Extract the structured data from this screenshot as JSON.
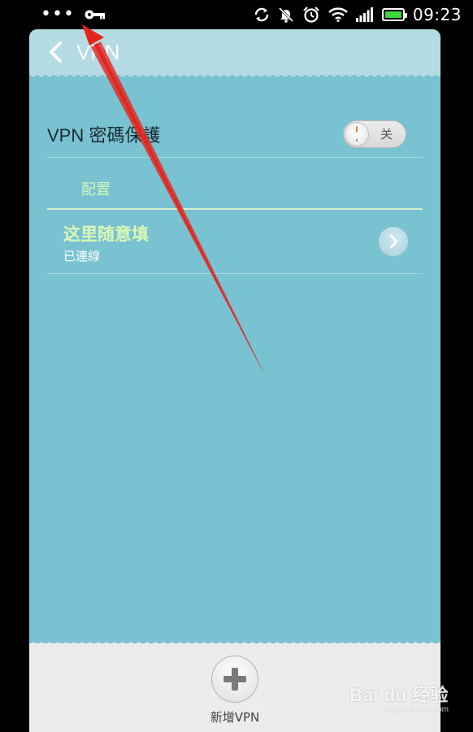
{
  "status_bar": {
    "left_icons": [
      "more-dots-icon",
      "vpn-key-icon"
    ],
    "right_icons": [
      "sync-icon",
      "notifications-muted-icon",
      "alarm-icon",
      "wifi-icon",
      "signal-icon",
      "battery-icon"
    ],
    "time": "09:23",
    "battery_color": "#3fd63f"
  },
  "header": {
    "title": "VPN"
  },
  "settings": {
    "password_protect_label": "VPN 密碼保護",
    "password_protect_state": "关",
    "section_title": "配置"
  },
  "vpn_list": [
    {
      "name": "这里随意填",
      "status": "已連線"
    }
  ],
  "bottom_bar": {
    "add_label": "新增VPN"
  },
  "watermark": {
    "main": "Bai du 经验",
    "sub": "jingyan.baidu.com"
  },
  "colors": {
    "background": "#78c2d2",
    "header": "#b5dbe5",
    "accent_green": "#d8f6b3",
    "annotation_red": "#e3241d"
  }
}
